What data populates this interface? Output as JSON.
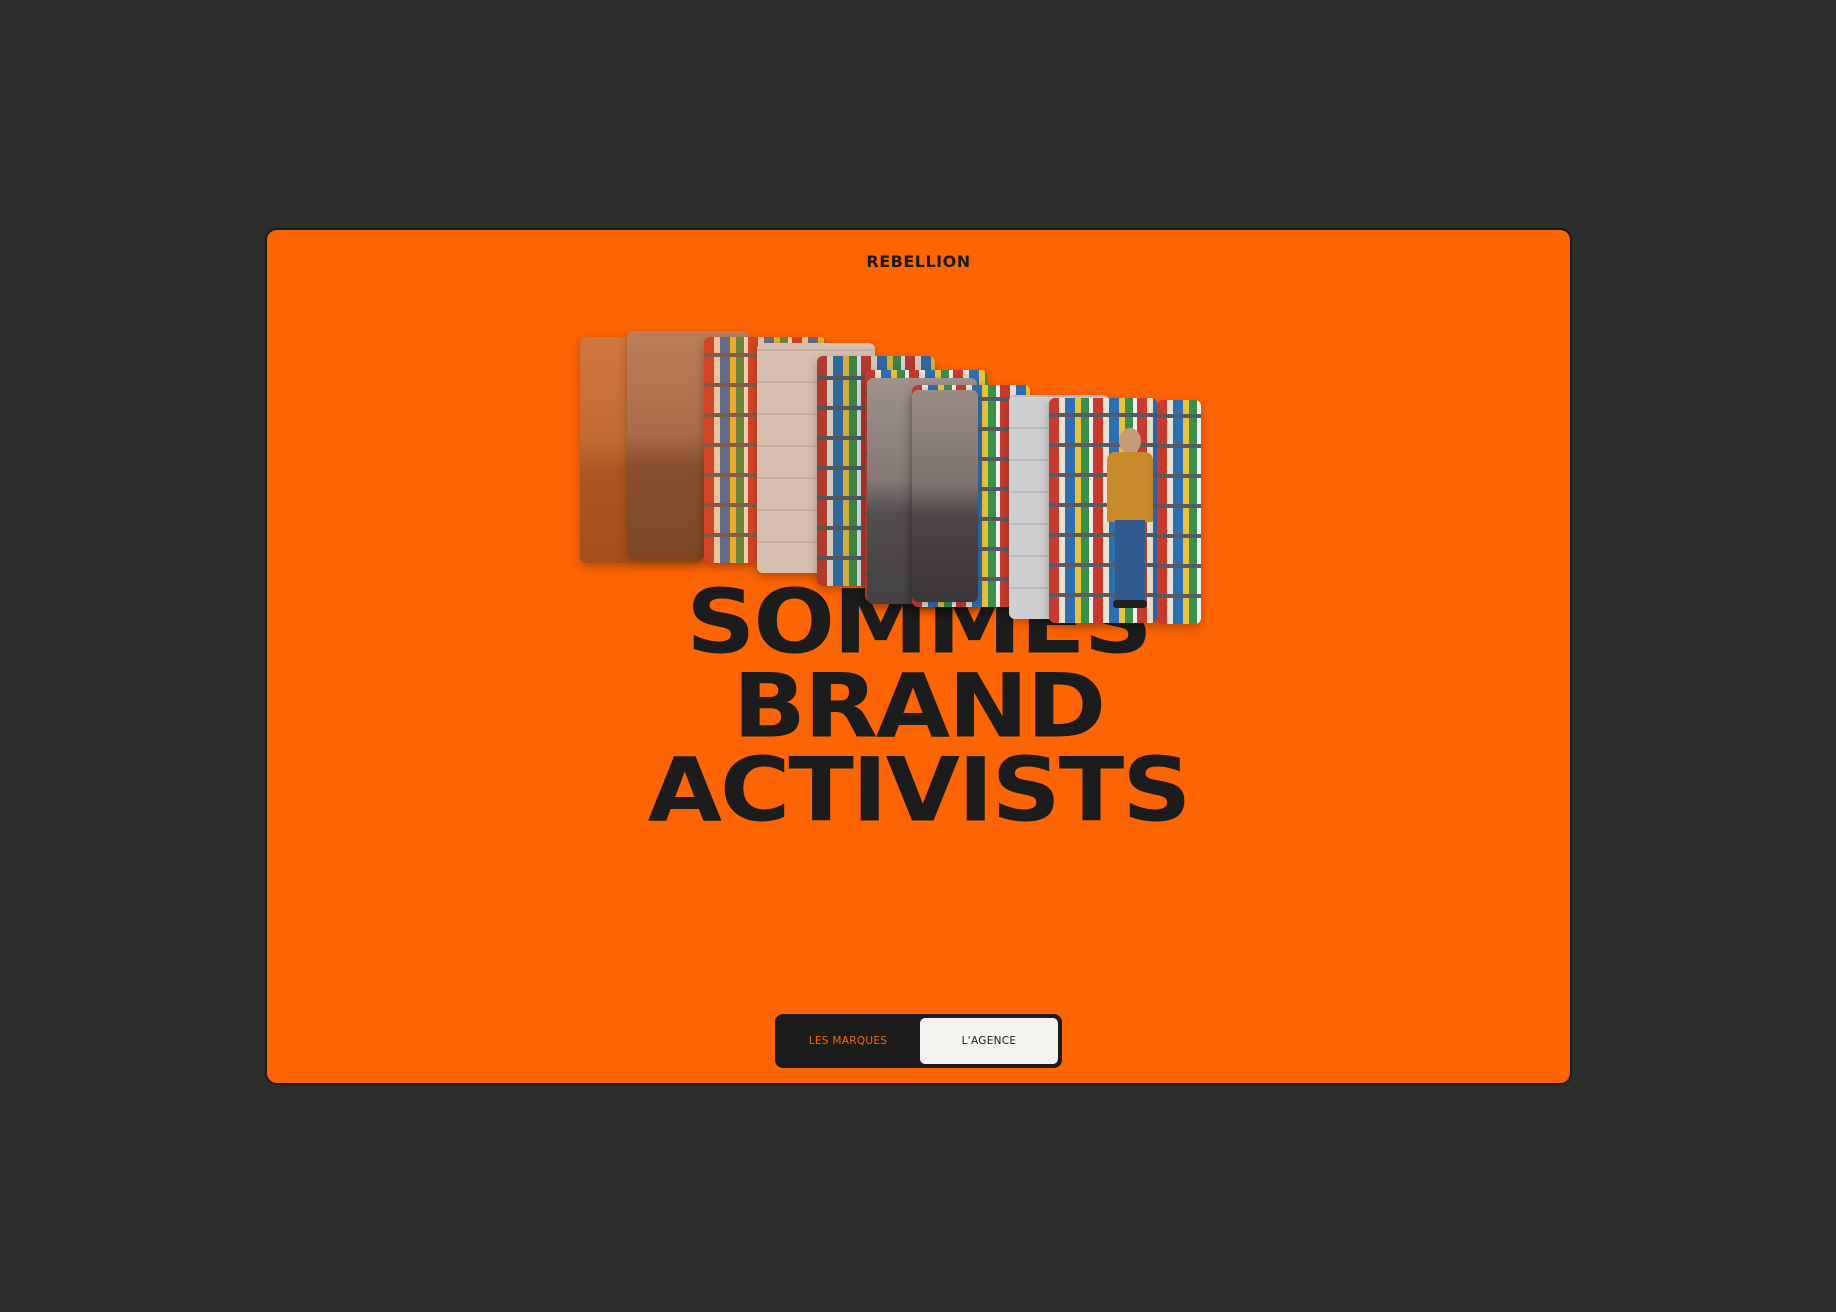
{
  "brand": {
    "logo": "REBELLION"
  },
  "headline": {
    "lines": [
      "SOMMES",
      "BRAND",
      "ACTIVISTS"
    ]
  },
  "nav_toggle": {
    "options": [
      {
        "label": "LES MARQUES",
        "selected": false
      },
      {
        "label": "L'AGENCE",
        "selected": true
      }
    ]
  },
  "colors": {
    "page_bg": "#2c2e2b",
    "accent": "#fd6404",
    "ink": "#1c1c1c",
    "toggle_selected_bg": "#f5f3ef"
  }
}
